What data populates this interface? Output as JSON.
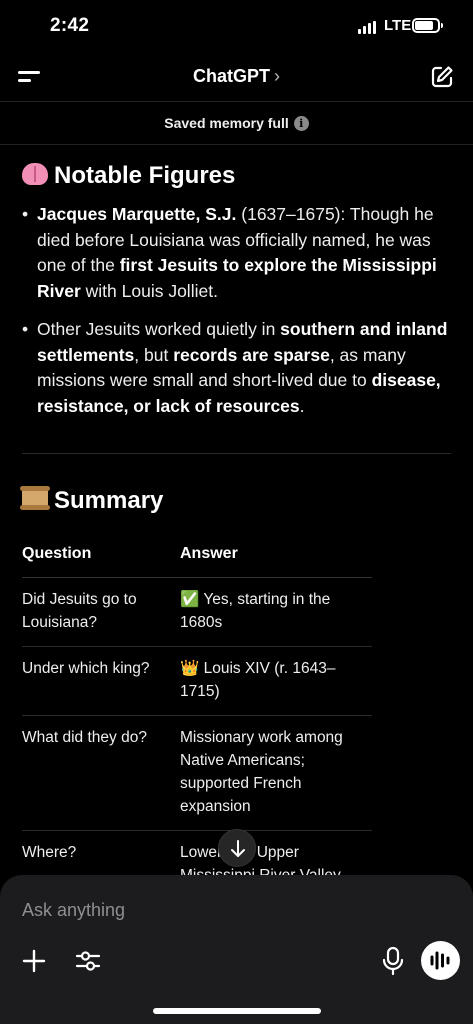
{
  "status_bar": {
    "time": "2:42",
    "network": "LTE",
    "battery_level": 0.8
  },
  "header": {
    "title": "ChatGPT",
    "chevron": "›"
  },
  "memory_notice": {
    "text": "Saved memory full",
    "icon": "info-icon"
  },
  "notable": {
    "heading": "Notable Figures",
    "heading_icon": "brain-emoji",
    "bullets": [
      [
        {
          "text": "Jacques Marquette, S.J.",
          "bold": true
        },
        {
          "text": " (1637–1675): Though he died before Louisiana was officially named, he was one of the ",
          "bold": false
        },
        {
          "text": "first Jesuits to explore the Mississippi River",
          "bold": true
        },
        {
          "text": " with Louis Jolliet.",
          "bold": false
        }
      ],
      [
        {
          "text": "Other Jesuits worked quietly in ",
          "bold": false
        },
        {
          "text": "southern and inland settlements",
          "bold": true
        },
        {
          "text": ", but ",
          "bold": false
        },
        {
          "text": "records are sparse",
          "bold": true
        },
        {
          "text": ", as many missions were small and short-lived due to ",
          "bold": false
        },
        {
          "text": "disease, resistance, or lack of resources",
          "bold": true
        },
        {
          "text": ".",
          "bold": false
        }
      ]
    ]
  },
  "summary": {
    "heading": "Summary",
    "heading_icon": "scroll-emoji",
    "columns": [
      "Question",
      "Answer"
    ],
    "rows": [
      [
        "Did Jesuits go to Louisiana?",
        "✅ Yes, starting in the 1680s"
      ],
      [
        "Under which king?",
        "👑 Louis XIV (r. 1643–1715)"
      ],
      [
        "What did they do?",
        "Missionary work among Native Americans; supported French expansion"
      ],
      [
        "Where?",
        "Lower and Upper Mississippi River Valley"
      ]
    ]
  },
  "composer": {
    "placeholder": "Ask anything"
  }
}
